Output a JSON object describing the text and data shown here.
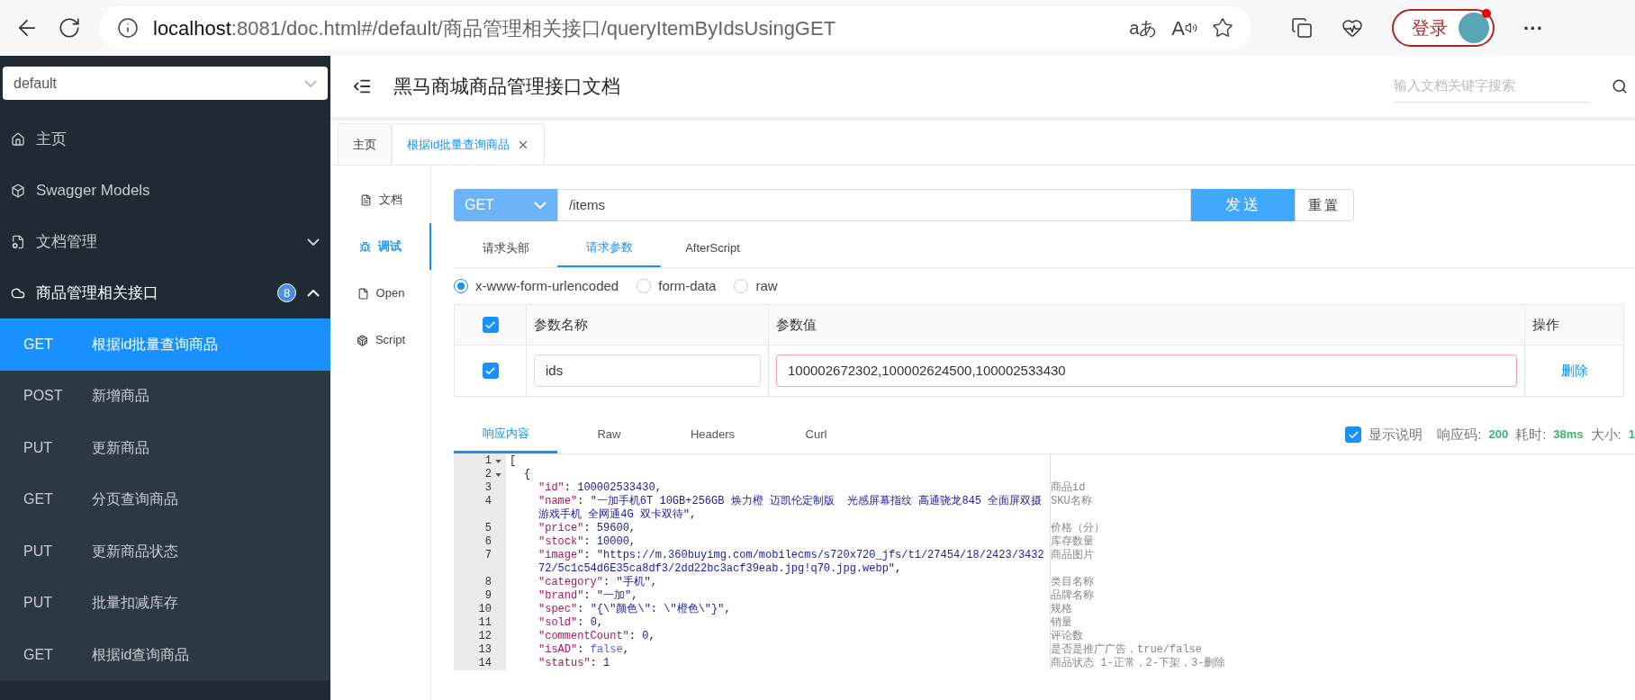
{
  "browser": {
    "host": "localhost",
    "path": ":8081/doc.html#/default/商品管理相关接口/queryItemByIdsUsingGET",
    "read_aloud": "aあ",
    "read_aloud_letter": "A",
    "login": "登录",
    "more": "···"
  },
  "sidebar": {
    "group_select": "default",
    "items": [
      {
        "kind": "home",
        "label": "主页",
        "expanded": false,
        "collapsible": false
      },
      {
        "kind": "models",
        "label": "Swagger Models",
        "expanded": false,
        "collapsible": false
      },
      {
        "kind": "docs",
        "label": "文档管理",
        "expanded": false,
        "collapsible": true
      },
      {
        "kind": "group",
        "label": "商品管理相关接口",
        "expanded": true,
        "collapsible": true,
        "badge": "8",
        "children": [
          {
            "method": "GET",
            "label": "根据id批量查询商品",
            "selected": true
          },
          {
            "method": "POST",
            "label": "新增商品",
            "selected": false
          },
          {
            "method": "PUT",
            "label": "更新商品",
            "selected": false
          },
          {
            "method": "GET",
            "label": "分页查询商品",
            "selected": false
          },
          {
            "method": "PUT",
            "label": "更新商品状态",
            "selected": false
          },
          {
            "method": "PUT",
            "label": "批量扣减库存",
            "selected": false
          },
          {
            "method": "GET",
            "label": "根据id查询商品",
            "selected": false
          }
        ]
      }
    ]
  },
  "header": {
    "title": "黑马商城商品管理接口文档",
    "search": {
      "placeholder": "输入文档关键字搜索"
    }
  },
  "tabs": [
    {
      "label": "主页",
      "selected": false,
      "closable": false
    },
    {
      "label": "根据id批量查询商品",
      "selected": true,
      "closable": true
    }
  ],
  "side_tabs": [
    {
      "kind": "doc",
      "label": "文档",
      "selected": false
    },
    {
      "kind": "debug",
      "label": "调试",
      "selected": true
    },
    {
      "kind": "open",
      "label": "Open",
      "selected": false
    },
    {
      "kind": "script",
      "label": "Script",
      "selected": false
    }
  ],
  "request": {
    "method": "GET",
    "url": "/items",
    "send": "发送",
    "reset": "重置"
  },
  "request_tabs": [
    {
      "label": "请求头部",
      "selected": false
    },
    {
      "label": "请求参数",
      "selected": true
    },
    {
      "label": "AfterScript",
      "selected": false
    }
  ],
  "content_types": [
    {
      "label": "x-www-form-urlencoded",
      "selected": true
    },
    {
      "label": "form-data",
      "selected": false
    },
    {
      "label": "raw",
      "selected": false
    }
  ],
  "params": {
    "all_checked": true,
    "columns": [
      "参数名称",
      "参数值",
      "操作"
    ],
    "rows": [
      {
        "checked": true,
        "name": "ids",
        "value": "100002672302,100002624500,100002533430",
        "action": "删除"
      }
    ]
  },
  "response_tabs": [
    {
      "label": "响应内容",
      "selected": true
    },
    {
      "label": "Raw",
      "selected": false
    },
    {
      "label": "Headers",
      "selected": false
    },
    {
      "label": "Curl",
      "selected": false
    }
  ],
  "response_meta": {
    "show_notes": {
      "label": "显示说明",
      "checked": true
    },
    "code_label": "响应码:",
    "code": "200",
    "time_label": "耗时:",
    "time": "38ms",
    "size_label": "大小:",
    "size": "1"
  },
  "code_lines": [
    {
      "number": "1",
      "kind": "root",
      "foldable": true,
      "tokens": [
        {
          "kind": "punct",
          "text": "["
        }
      ]
    },
    {
      "number": "2",
      "kind": "object",
      "foldable": true,
      "tokens": [
        {
          "kind": "punct",
          "text": "{"
        }
      ]
    },
    {
      "number": "3",
      "kind": "member",
      "foldable": false,
      "note": "商品id",
      "tokens": [
        {
          "kind": "key",
          "text": "\"id\""
        },
        {
          "kind": "punct",
          "text": ": "
        },
        {
          "kind": "number",
          "text": "100002533430"
        },
        {
          "kind": "punct",
          "text": ","
        }
      ]
    },
    {
      "number": "4",
      "kind": "member",
      "foldable": false,
      "note": "SKU名称",
      "tokens": [
        {
          "kind": "key",
          "text": "\"name\""
        },
        {
          "kind": "punct",
          "text": ": "
        },
        {
          "kind": "string",
          "text": "\"一加手机6T 10GB+256GB 焕力橙 迈凯伦定制版  光感屏幕指纹 高通骁龙845 全面屏双摄游戏手机 全网通4G 双卡双待\""
        },
        {
          "kind": "punct",
          "text": ","
        }
      ]
    },
    {
      "number": "5",
      "kind": "member",
      "foldable": false,
      "note": "价格（分）",
      "tokens": [
        {
          "kind": "key",
          "text": "\"price\""
        },
        {
          "kind": "punct",
          "text": ": "
        },
        {
          "kind": "number",
          "text": "59600"
        },
        {
          "kind": "punct",
          "text": ","
        }
      ]
    },
    {
      "number": "6",
      "kind": "member",
      "foldable": false,
      "note": "库存数量",
      "tokens": [
        {
          "kind": "key",
          "text": "\"stock\""
        },
        {
          "kind": "punct",
          "text": ": "
        },
        {
          "kind": "number",
          "text": "10000"
        },
        {
          "kind": "punct",
          "text": ","
        }
      ]
    },
    {
      "number": "7",
      "kind": "member",
      "foldable": false,
      "note": "商品图片",
      "tokens": [
        {
          "kind": "key",
          "text": "\"image\""
        },
        {
          "kind": "punct",
          "text": ": "
        },
        {
          "kind": "string",
          "text": "\"https://m.360buyimg.com/mobilecms/s720x720_jfs/t1/27454/18/2423/343272/5c1c54d6E35ca8df3/2dd22bc3acf39eab.jpg!q70.jpg.webp\""
        },
        {
          "kind": "punct",
          "text": ","
        }
      ]
    },
    {
      "number": "8",
      "kind": "member",
      "foldable": false,
      "note": "类目名称",
      "tokens": [
        {
          "kind": "key",
          "text": "\"category\""
        },
        {
          "kind": "punct",
          "text": ": "
        },
        {
          "kind": "string",
          "text": "\"手机\""
        },
        {
          "kind": "punct",
          "text": ","
        }
      ]
    },
    {
      "number": "9",
      "kind": "member",
      "foldable": false,
      "note": "品牌名称",
      "tokens": [
        {
          "kind": "key",
          "text": "\"brand\""
        },
        {
          "kind": "punct",
          "text": ": "
        },
        {
          "kind": "string",
          "text": "\"一加\""
        },
        {
          "kind": "punct",
          "text": ","
        }
      ]
    },
    {
      "number": "10",
      "kind": "member",
      "foldable": false,
      "note": "规格",
      "tokens": [
        {
          "kind": "key",
          "text": "\"spec\""
        },
        {
          "kind": "punct",
          "text": ": "
        },
        {
          "kind": "string",
          "text": "\"{\\\"颜色\\\": \\\"橙色\\\"}\""
        },
        {
          "kind": "punct",
          "text": ","
        }
      ]
    },
    {
      "number": "11",
      "kind": "member",
      "foldable": false,
      "note": "销量",
      "tokens": [
        {
          "kind": "key",
          "text": "\"sold\""
        },
        {
          "kind": "punct",
          "text": ": "
        },
        {
          "kind": "number",
          "text": "0"
        },
        {
          "kind": "punct",
          "text": ","
        }
      ]
    },
    {
      "number": "12",
      "kind": "member",
      "foldable": false,
      "note": "评论数",
      "tokens": [
        {
          "kind": "key",
          "text": "\"commentCount\""
        },
        {
          "kind": "punct",
          "text": ": "
        },
        {
          "kind": "number",
          "text": "0"
        },
        {
          "kind": "punct",
          "text": ","
        }
      ]
    },
    {
      "number": "13",
      "kind": "member",
      "foldable": false,
      "note": "是否是推广广告，true/false",
      "tokens": [
        {
          "kind": "key",
          "text": "\"isAD\""
        },
        {
          "kind": "punct",
          "text": ": "
        },
        {
          "kind": "bool",
          "text": "false"
        },
        {
          "kind": "punct",
          "text": ","
        }
      ]
    },
    {
      "number": "14",
      "kind": "member",
      "foldable": false,
      "note": "商品状态 1-正常，2-下架，3-删除",
      "tokens": [
        {
          "kind": "key",
          "text": "\"status\""
        },
        {
          "kind": "punct",
          "text": ": "
        },
        {
          "kind": "number",
          "text": "1"
        }
      ]
    }
  ]
}
